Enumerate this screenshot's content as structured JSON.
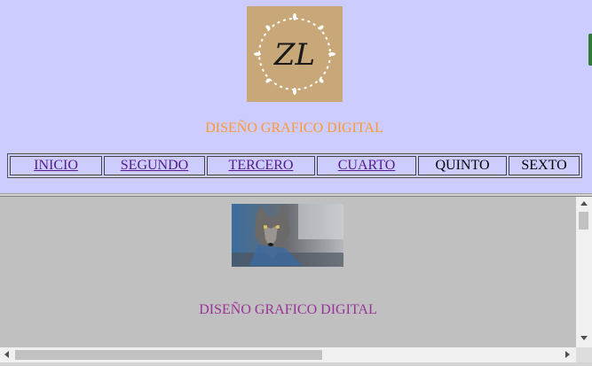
{
  "top_frame": {
    "logo": {
      "text": "ZL",
      "icon": "monogram-laurel-logo"
    },
    "title": "DISEÑO GRAFICO DIGITAL",
    "title_color": "#ff9933",
    "nav": [
      {
        "label": "INICIO",
        "link": true
      },
      {
        "label": "SEGUNDO",
        "link": true
      },
      {
        "label": "TERCERO",
        "link": true
      },
      {
        "label": "CUARTO",
        "link": true
      },
      {
        "label": "QUINTO",
        "link": false
      },
      {
        "label": "SEXTO",
        "link": false
      }
    ]
  },
  "bottom_frame": {
    "image": "wolf-photo",
    "title": "DISEÑO GRAFICO DIGITAL",
    "title_color": "#993399"
  },
  "colors": {
    "top_bg": "#ccccff",
    "bottom_bg": "#c0c0c0",
    "link": "#551a8b"
  }
}
